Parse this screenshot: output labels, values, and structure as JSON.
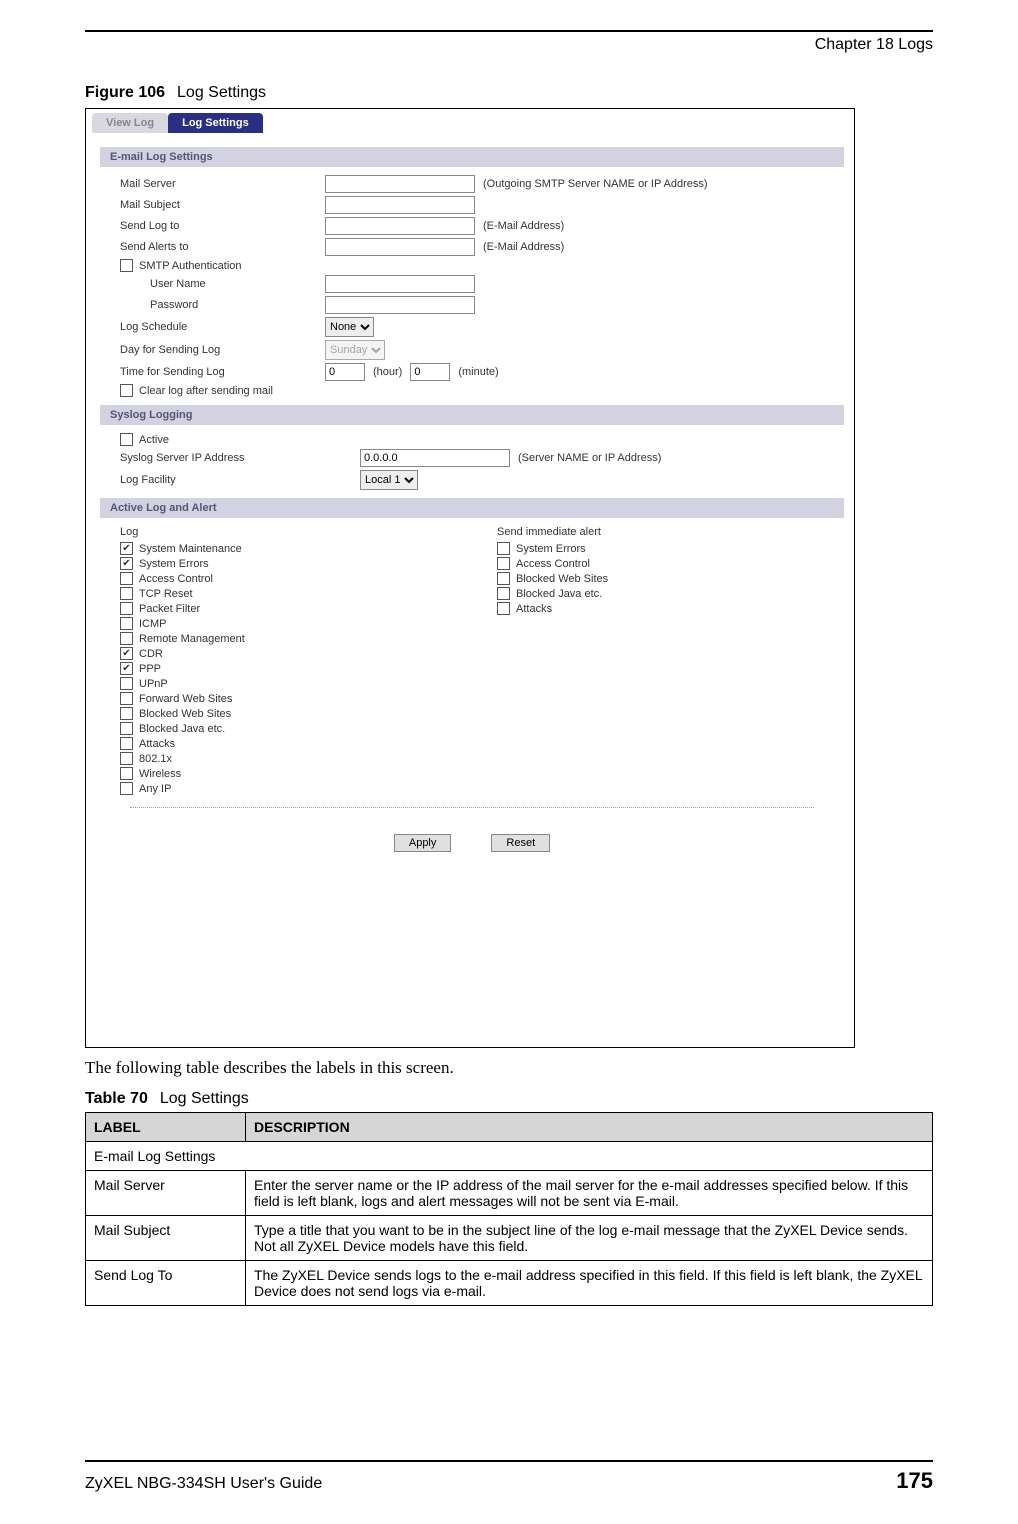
{
  "header": {
    "chapter": "Chapter 18 Logs"
  },
  "figure": {
    "label": "Figure 106",
    "title": "Log Settings"
  },
  "screenshot": {
    "tabs": {
      "view_log": "View Log",
      "log_settings": "Log Settings"
    },
    "sections": {
      "email": "E-mail Log Settings",
      "syslog": "Syslog Logging",
      "active": "Active Log and Alert"
    },
    "email": {
      "mail_server_label": "Mail Server",
      "mail_server_hint": "(Outgoing SMTP Server NAME or IP Address)",
      "mail_subject_label": "Mail Subject",
      "send_log_to_label": "Send Log to",
      "send_log_to_hint": "(E-Mail Address)",
      "send_alerts_to_label": "Send Alerts to",
      "send_alerts_to_hint": "(E-Mail Address)",
      "smtp_auth_label": "SMTP Authentication",
      "user_name_label": "User Name",
      "password_label": "Password",
      "log_schedule_label": "Log Schedule",
      "log_schedule_value": "None",
      "day_label": "Day for Sending Log",
      "day_value": "Sunday",
      "time_label": "Time for Sending Log",
      "time_hour": "0",
      "time_hour_suffix": "(hour)",
      "time_minute": "0",
      "time_minute_suffix": "(minute)",
      "clear_log_label": "Clear log after sending mail"
    },
    "syslog": {
      "active_label": "Active",
      "server_label": "Syslog Server IP Address",
      "server_value": "0.0.0.0",
      "server_hint": "(Server NAME or IP Address)",
      "facility_label": "Log Facility",
      "facility_value": "Local 1"
    },
    "active": {
      "log_header": "Log",
      "alert_header": "Send immediate alert",
      "log_items": [
        {
          "label": "System Maintenance",
          "checked": true
        },
        {
          "label": "System Errors",
          "checked": true
        },
        {
          "label": "Access Control",
          "checked": false
        },
        {
          "label": "TCP Reset",
          "checked": false
        },
        {
          "label": "Packet Filter",
          "checked": false
        },
        {
          "label": "ICMP",
          "checked": false
        },
        {
          "label": "Remote Management",
          "checked": false
        },
        {
          "label": "CDR",
          "checked": true
        },
        {
          "label": "PPP",
          "checked": true
        },
        {
          "label": "UPnP",
          "checked": false
        },
        {
          "label": "Forward Web Sites",
          "checked": false
        },
        {
          "label": "Blocked Web Sites",
          "checked": false
        },
        {
          "label": "Blocked Java etc.",
          "checked": false
        },
        {
          "label": "Attacks",
          "checked": false
        },
        {
          "label": "802.1x",
          "checked": false
        },
        {
          "label": "Wireless",
          "checked": false
        },
        {
          "label": "Any IP",
          "checked": false
        }
      ],
      "alert_items": [
        {
          "label": "System Errors",
          "checked": false
        },
        {
          "label": "Access Control",
          "checked": false
        },
        {
          "label": "Blocked Web Sites",
          "checked": false
        },
        {
          "label": "Blocked Java etc.",
          "checked": false
        },
        {
          "label": "Attacks",
          "checked": false
        }
      ]
    },
    "buttons": {
      "apply": "Apply",
      "reset": "Reset"
    }
  },
  "body_text": "The following table describes the labels in this screen.",
  "table": {
    "label": "Table 70",
    "title": "Log Settings",
    "headers": {
      "c1": "LABEL",
      "c2": "DESCRIPTION"
    },
    "rows": [
      {
        "label": "E-mail Log Settings",
        "desc": "",
        "span": true
      },
      {
        "label": "Mail Server",
        "desc": "Enter the server name or the IP address of the mail server for the e-mail addresses specified below. If this field is left blank, logs and alert messages will not be sent via E-mail."
      },
      {
        "label": "Mail Subject",
        "desc": "Type a title that you want to be in the subject line of the log e-mail message that the ZyXEL Device sends. Not all ZyXEL Device models have this field."
      },
      {
        "label": "Send Log To",
        "desc": "The ZyXEL Device sends logs to the e-mail address specified in this field. If this field is left blank, the ZyXEL Device does not send logs via e-mail."
      }
    ]
  },
  "footer": {
    "guide": "ZyXEL NBG-334SH User's Guide",
    "page": "175"
  }
}
